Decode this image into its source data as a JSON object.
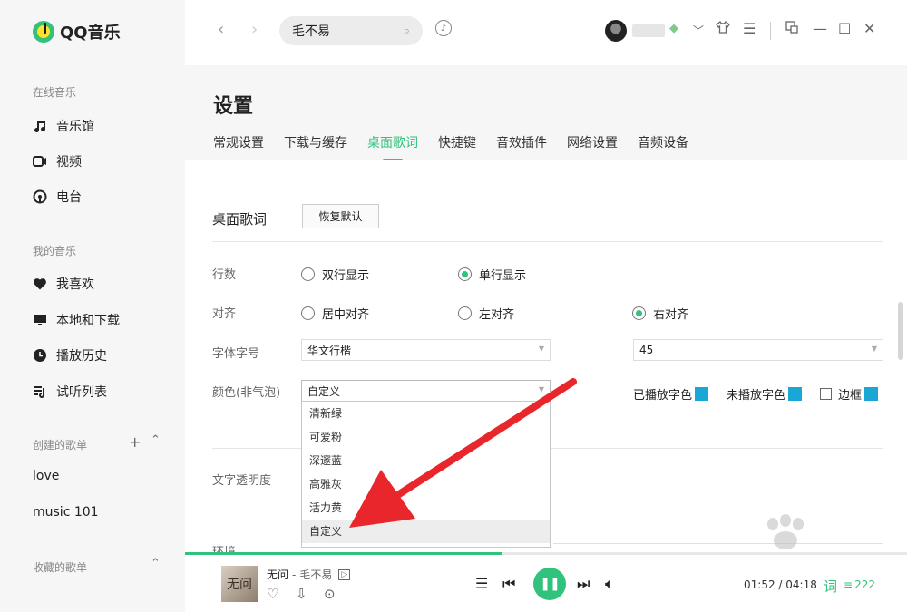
{
  "app": {
    "name": "QQ音乐",
    "colors": {
      "accent": "#31c27c",
      "swatch": "#1aa7d6",
      "arrow": "#e8262b"
    }
  },
  "sidebar": {
    "online_section": "在线音乐",
    "online_items": [
      {
        "label": "音乐馆",
        "icon": "music-note-icon"
      },
      {
        "label": "视频",
        "icon": "video-icon"
      },
      {
        "label": "电台",
        "icon": "radio-icon"
      }
    ],
    "my_section": "我的音乐",
    "my_items": [
      {
        "label": "我喜欢",
        "icon": "heart-icon"
      },
      {
        "label": "本地和下载",
        "icon": "monitor-icon"
      },
      {
        "label": "播放历史",
        "icon": "clock-icon"
      },
      {
        "label": "试听列表",
        "icon": "playlist-icon"
      }
    ],
    "created_section": "创建的歌单",
    "created_playlists": [
      "love",
      "music 101"
    ],
    "collected_section": "收藏的歌单"
  },
  "topbar": {
    "search_value": "毛不易"
  },
  "settings": {
    "title": "设置",
    "tabs": [
      "常规设置",
      "下载与缓存",
      "桌面歌词",
      "快捷键",
      "音效插件",
      "网络设置",
      "音频设备"
    ],
    "active_tab": "桌面歌词",
    "section_title": "桌面歌词",
    "reset_label": "恢复默认",
    "lines_label": "行数",
    "lines_options": [
      "双行显示",
      "单行显示"
    ],
    "lines_selected": "单行显示",
    "align_label": "对齐",
    "align_options": [
      "居中对齐",
      "左对齐",
      "右对齐"
    ],
    "align_selected": "右对齐",
    "font_label": "字体字号",
    "font_value": "华文行楷",
    "size_value": "45",
    "color_label": "颜色(非气泡)",
    "color_value": "自定义",
    "color_options": [
      "清新绿",
      "可爱粉",
      "深邃蓝",
      "高雅灰",
      "活力黄",
      "自定义"
    ],
    "color_hovered": "自定义",
    "played_color_label": "已播放字色",
    "unplayed_color_label": "未播放字色",
    "border_label": "边框",
    "opacity_label": "文字透明度",
    "cut_label": "环境"
  },
  "player": {
    "cover_text": "无问",
    "song": "无问",
    "separator": "-",
    "artist": "毛不易",
    "mv_badge": "▷",
    "time": "01:52 / 04:18",
    "lyric_label": "词",
    "count": "222",
    "progress": 0.44
  }
}
